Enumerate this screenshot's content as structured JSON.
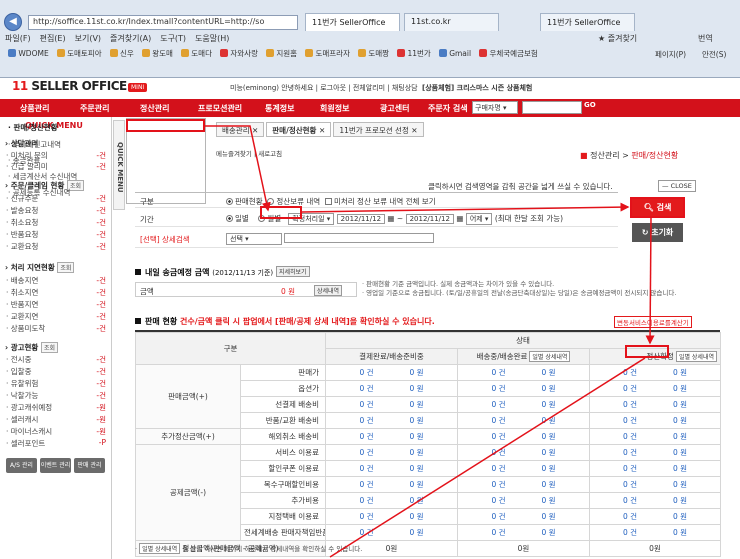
{
  "browser": {
    "url": "http://soffice.11st.co.kr/Index.tmall?contentURL=http://so",
    "tabs": [
      "11번가 SellerOffice",
      "11st.co.kr",
      "11번가 SellerOffice"
    ],
    "menus": [
      "파일(F)",
      "편집(E)",
      "보기(V)",
      "즐겨찾기(A)",
      "도구(T)",
      "도움말(H)"
    ],
    "favorites": [
      "WDOME",
      "도매토피아",
      "신우",
      "왕도매",
      "도매다",
      "자와사랑",
      "지원홈",
      "도매프라자",
      "도매짱",
      "11번가",
      "Gmail",
      "우체국예금보험"
    ],
    "toolbar_right": [
      "즐겨찾기",
      "번역"
    ],
    "toolbar_right2": [
      "페이지(P)",
      "안전(S)"
    ]
  },
  "site": {
    "logo": "SELLER OFFICE",
    "mini": "MINI",
    "userline": "미능(eminong) 안녕하세요 | 로그아웃 | 전체알리미 | 채팅상담",
    "notice": "[상품체험] 크리스마스 시즌 상품체험",
    "nav": [
      "상품관리",
      "주문관리",
      "정산관리",
      "프로모션관리",
      "통계정보",
      "회원정보",
      "광고센터"
    ],
    "search_label": "주문자 검색",
    "search_select": "구매자명",
    "go": "GO"
  },
  "quick": {
    "title": "QUICK MENU",
    "vertical": "QUICK MENU",
    "sections": [
      {
        "title": "상담관리",
        "btn": "",
        "items": [
          {
            "label": "미처리 문의",
            "count": "-건"
          },
          {
            "label": "긴급 알리미",
            "count": "-건"
          }
        ]
      },
      {
        "title": "주문/클레임 현황",
        "btn": "조회",
        "items": [
          {
            "label": "신규주문",
            "count": "-건"
          },
          {
            "label": "발송요청",
            "count": "-건"
          },
          {
            "label": "취소요청",
            "count": "-건"
          },
          {
            "label": "반품요청",
            "count": "-건"
          },
          {
            "label": "교환요청",
            "count": "-건"
          }
        ]
      },
      {
        "title": "처리 지연현황",
        "btn": "조회",
        "items": [
          {
            "label": "배송지연",
            "count": "-건"
          },
          {
            "label": "취소지연",
            "count": "-건"
          },
          {
            "label": "반품지연",
            "count": "-건"
          },
          {
            "label": "교환지연",
            "count": "-건"
          },
          {
            "label": "상품미도착",
            "count": "-건"
          }
        ]
      },
      {
        "title": "광고현황",
        "btn": "조회",
        "items": [
          {
            "label": "전시중",
            "count": "-건"
          },
          {
            "label": "입찰중",
            "count": "-건"
          },
          {
            "label": "유찰위험",
            "count": "-건"
          },
          {
            "label": "낙찰가능",
            "count": "-건"
          },
          {
            "label": "광고캐쉬예정",
            "count": "-원"
          },
          {
            "label": "셀러캐시",
            "count": "-원"
          },
          {
            "label": "마이너스캐시",
            "count": "-원"
          },
          {
            "label": "셀러포인트",
            "count": "-P"
          }
        ]
      }
    ],
    "buttons": [
      "A/S 관리",
      "이벤트 관리",
      "판매 관리"
    ]
  },
  "dropdown": [
    "판매/정산현황",
    "부가세신고내역",
    "송금완료",
    "세금계산서 수신내역",
    "공제등록 수신내역"
  ],
  "inner_tabs": [
    "배송관리",
    "판매/정산현황",
    "11번가 프로모션 선정"
  ],
  "crumbs": "메뉴즐겨찾기 | 새로고침",
  "breadcrumb": {
    "prefix": "정산관리 >",
    "current": "판매/정산현황"
  },
  "hint": {
    "text": "클릭하시면 검색영역을 감춰 공간을 넓게 쓰실 수 있습니다.",
    "close": "CLOSE"
  },
  "form": {
    "gubun_label": "구분",
    "gubun_opts": [
      "판매현황",
      "정산보류 내역",
      "미처리 정산 보류 내역 전체 보기"
    ],
    "period_label": "기간",
    "period_opts": [
      "일별",
      "월별"
    ],
    "date_type": "확정처리일",
    "date_from": "2012/11/12",
    "date_to": "2012/11/12",
    "range": "어제",
    "range_note": "(최대 한달 조회 가능)",
    "detail_label": "[선택] 상세검색",
    "detail_sel": "선택",
    "search": "검색",
    "reset": "초기화"
  },
  "remit": {
    "title": "내일 송금예정 금액",
    "date": "(2012/11/13 기준)",
    "btn": "지세히보기",
    "amount_label": "금액",
    "amount": "0 원",
    "detail": "상세내역",
    "notes": [
      "· 판매현황 기준 금액입니다. 실제 송금액과는 차이가 있을 수 있습니다.",
      "· 영업일 기준으로 송금됩니다. (토/일/공휴일의 전날(송금단축대상일)는 당일)은 송금예정금액이 전시되지 않습니다."
    ]
  },
  "status": {
    "title": "판매 현황",
    "guide": "건수/금액 클릭 시 팝업에서 [판매/공제 상세 내역]을 확인하실 수 있습니다.",
    "diff_btn": "변동서비스이용료를계산기",
    "header": {
      "gubun": "구분",
      "state": "상태",
      "cols": [
        "결제완료/배송준비중",
        "배송중/배송완료",
        "정산확정"
      ],
      "detail_btn": "일별 상세내역"
    },
    "groups": [
      {
        "label": "판매금액(+)",
        "rows": [
          "판매가",
          "옵션가",
          "선결제 배송비",
          "반품/교환 배송비"
        ]
      },
      {
        "label": "추가정산금액(+)",
        "rows": [
          "해외취소 배송비"
        ]
      },
      {
        "label": "공제금액(-)",
        "rows": [
          "서비스 이용료",
          "할인쿠폰 이용료",
          "복수구매할인비용",
          "추가비용",
          "지정택배 이용료",
          "전세계배송 판매자책임반품"
        ]
      }
    ],
    "cell": {
      "count": "0 건",
      "won": "0 원"
    },
    "total_label": "정산금액(판매금액 - 공제금액)",
    "total": "0원"
  },
  "footnote": {
    "btn": "일별 상세내역",
    "text": "을 클릭 하시면 페이지 하단에서 상세내역을 확인하실 수 있습니다."
  },
  "colors": {
    "brand": "#e31a1c",
    "nav": "#d3111b",
    "link": "#1f5fbf"
  }
}
